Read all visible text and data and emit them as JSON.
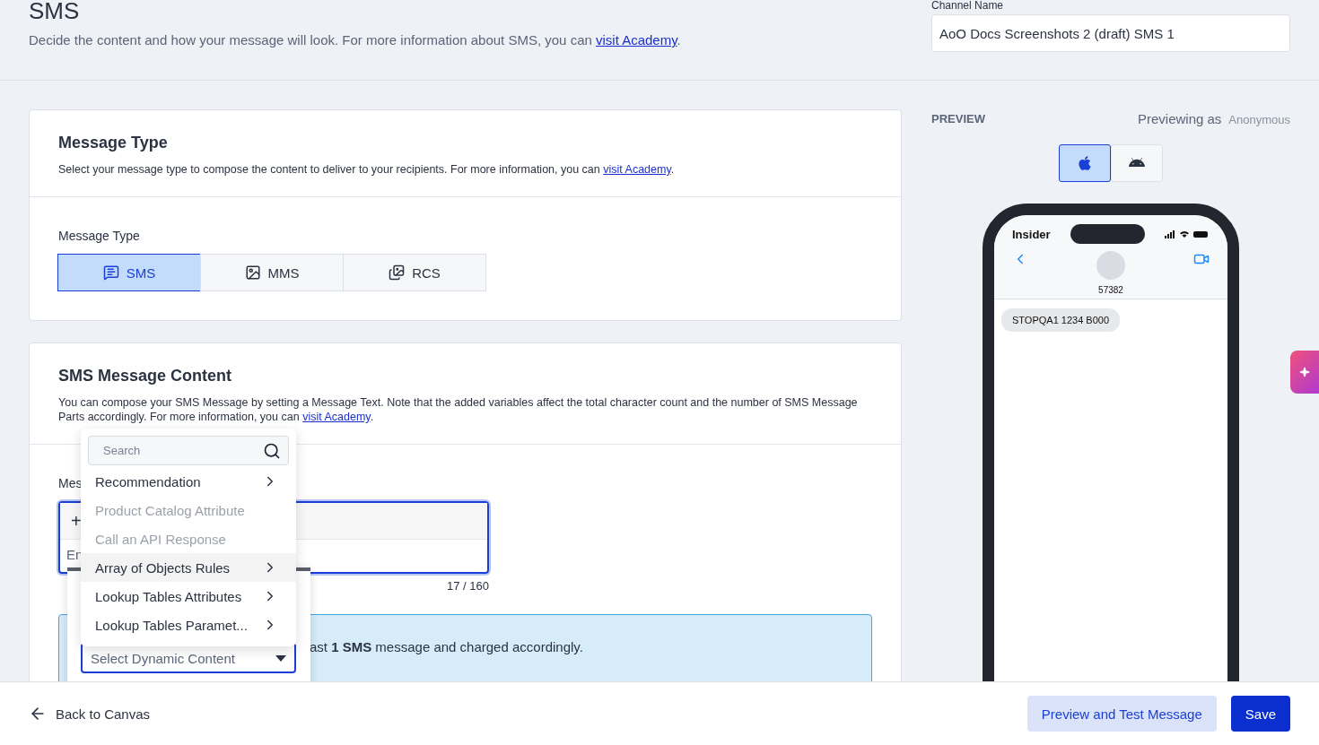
{
  "header": {
    "title": "SMS",
    "description": {
      "text": "Decide the content and how your message will look. For more information about SMS, you can",
      "link": "visit Academy",
      "end": "."
    }
  },
  "channel_name": {
    "label": "Channel Name",
    "value": "AoO Docs Screenshots 2 (draft) SMS 1"
  },
  "message_type_card": {
    "title": "Message Type",
    "description": {
      "text": "Select your message type to compose the content to deliver to your recipients. For more information, you can",
      "link": "visit Academy",
      "end": "."
    },
    "field_label": "Message Type",
    "options": [
      {
        "label": "SMS",
        "kind": "sms",
        "selected": true
      },
      {
        "label": "MMS",
        "kind": "mms",
        "selected": false
      },
      {
        "label": "RCS",
        "kind": "rcs",
        "selected": false
      }
    ]
  },
  "content_card": {
    "title": "SMS Message Content",
    "description": {
      "text": "You can compose your SMS Message by setting a Message Text. Note that the added variables affect the total character count and the number of SMS Message Parts accordingly. For more information, you can",
      "link": "visit Academy",
      "end": "."
    },
    "field_label": "Mes",
    "add_button": "+",
    "placeholder": "En",
    "counter": "17 / 160",
    "info": "ast **1 SMS** message and charged accordingly."
  },
  "dynamic_menu": {
    "search_placeholder": "Search",
    "items": [
      {
        "label": "Recommendation",
        "disabled": false,
        "selected": false,
        "submenu": true
      },
      {
        "label": "Product Catalog Attribute",
        "disabled": true,
        "selected": false,
        "submenu": false
      },
      {
        "label": "Call an API Response",
        "disabled": true,
        "selected": false,
        "submenu": false
      },
      {
        "label": "Array of Objects Rules",
        "disabled": false,
        "selected": true,
        "submenu": true
      },
      {
        "label": "Lookup Tables Attributes",
        "disabled": false,
        "selected": false,
        "submenu": true
      },
      {
        "label": "Lookup Tables Paramet...",
        "disabled": false,
        "selected": false,
        "submenu": true
      }
    ],
    "select": {
      "placeholder": "Select Dynamic Content"
    }
  },
  "preview": {
    "heading": "PREVIEW",
    "previewing_label": "Previewing as",
    "persona": "Anonymous",
    "devices": [
      {
        "kind": "ios",
        "selected": true
      },
      {
        "kind": "android",
        "selected": false
      }
    ],
    "phone": {
      "carrier": "Insider",
      "sender": "57382",
      "messages": [
        "STOPQA1 1234 B000"
      ]
    }
  },
  "footer": {
    "back": "Back to Canvas",
    "buttons": [
      {
        "label": "Preview and Test Message",
        "kind": "secondary"
      },
      {
        "label": "Save",
        "kind": "primary"
      }
    ]
  }
}
